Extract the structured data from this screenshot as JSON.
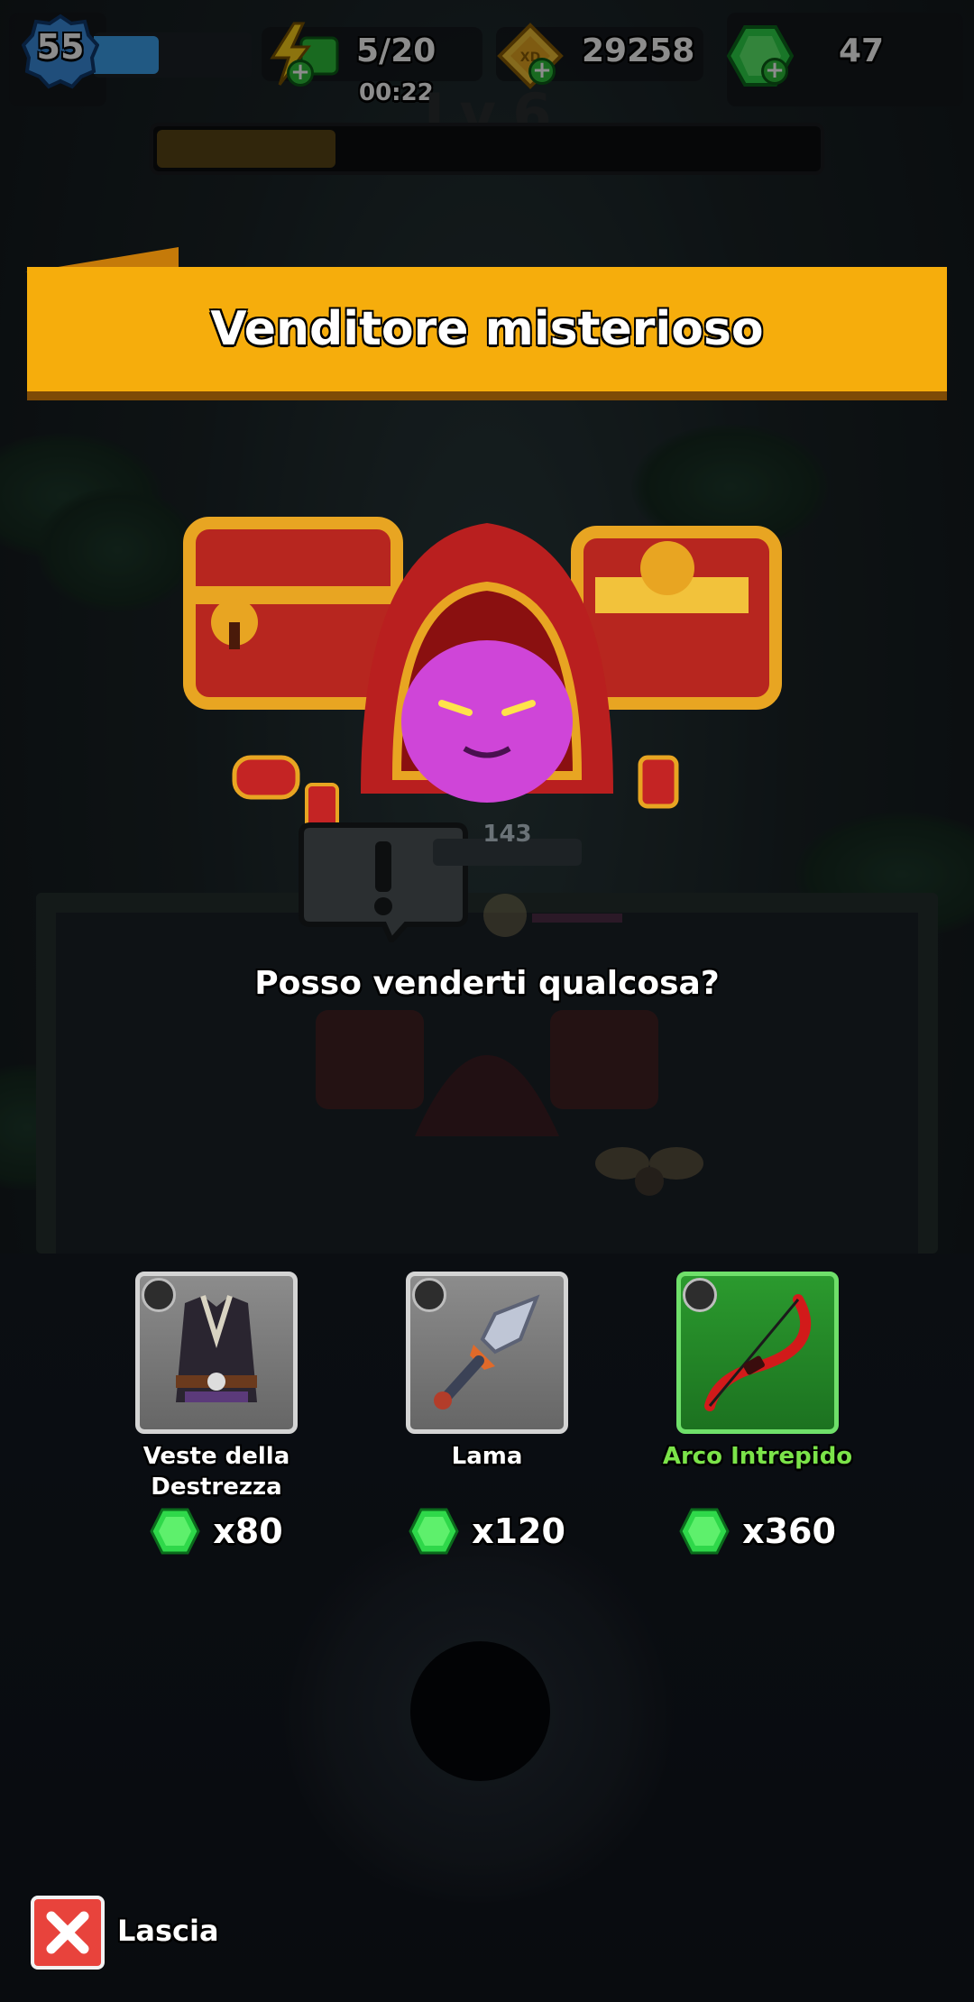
{
  "hud": {
    "level": "55",
    "energy": "5/20",
    "energy_timer": "00:22",
    "gold": "29258",
    "gems": "47",
    "stage_label": "Lv.6",
    "stage_progress": 0.27
  },
  "dialog": {
    "title": "Venditore misterioso",
    "question": "Posso venderti qualcosa?",
    "hp_value": "143"
  },
  "items": [
    {
      "name": "Veste della Destrezza",
      "price": "x80",
      "slot_icon": "armor-slot-icon",
      "art": "robe-icon",
      "rarity_color": "#d4d4d4"
    },
    {
      "name": "Lama",
      "price": "x120",
      "slot_icon": "weapon-slot-icon",
      "art": "sword-icon",
      "rarity_color": "#d4d4d4"
    },
    {
      "name": "Arco Intrepido",
      "price": "x360",
      "slot_icon": "weapon-slot-icon",
      "art": "bow-icon",
      "rarity_color": "#6fe06a"
    }
  ],
  "leave": {
    "label": "Lascia"
  },
  "colors": {
    "banner": "#f6ad0c",
    "gem": "#2fd84a",
    "close": "#e8433c",
    "rare_text": "#7be349"
  }
}
